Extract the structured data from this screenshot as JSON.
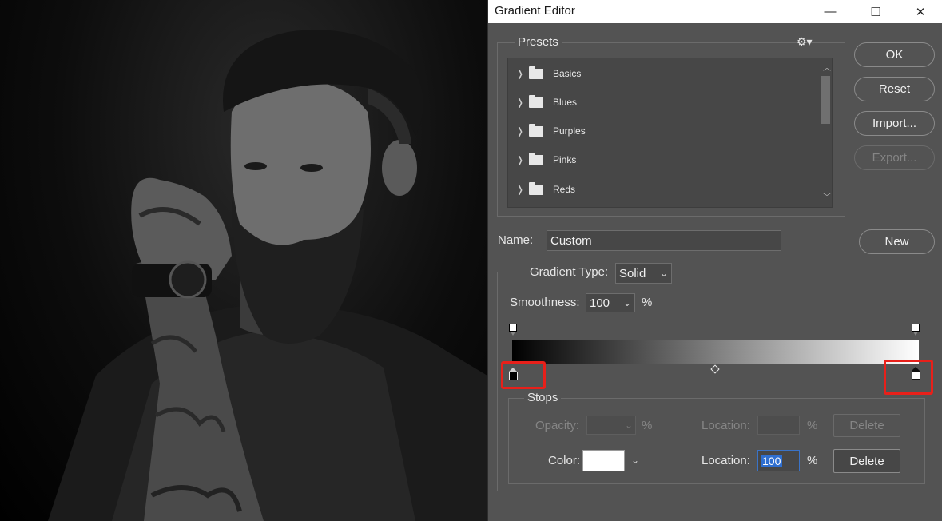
{
  "window": {
    "title": "Gradient Editor",
    "controls": {
      "minimize": "—",
      "maximize": "☐",
      "close": "✕"
    }
  },
  "presets": {
    "label": "Presets",
    "gear_icon": "gear-icon",
    "items": [
      {
        "label": "Basics"
      },
      {
        "label": "Blues"
      },
      {
        "label": "Purples"
      },
      {
        "label": "Pinks"
      },
      {
        "label": "Reds"
      }
    ]
  },
  "buttons": {
    "ok": "OK",
    "reset": "Reset",
    "import": "Import...",
    "export": "Export...",
    "new": "New",
    "delete_opacity": "Delete",
    "delete_color": "Delete"
  },
  "name": {
    "label": "Name:",
    "value": "Custom"
  },
  "gradient_type": {
    "label": "Gradient Type:",
    "value": "Solid"
  },
  "smoothness": {
    "label": "Smoothness:",
    "value": "100",
    "unit": "%"
  },
  "gradient": {
    "start_color": "#000000",
    "end_color": "#ffffff"
  },
  "stops": {
    "label": "Stops",
    "opacity_label": "Opacity:",
    "opacity_unit": "%",
    "opacity_location_label": "Location:",
    "opacity_location_unit": "%",
    "color_label": "Color:",
    "color_value": "#ffffff",
    "color_location_label": "Location:",
    "color_location_value": "100",
    "color_location_unit": "%"
  },
  "colors": {
    "dialog_bg": "#535353",
    "highlight": "#e8201a",
    "selection": "#2f6fd0"
  }
}
